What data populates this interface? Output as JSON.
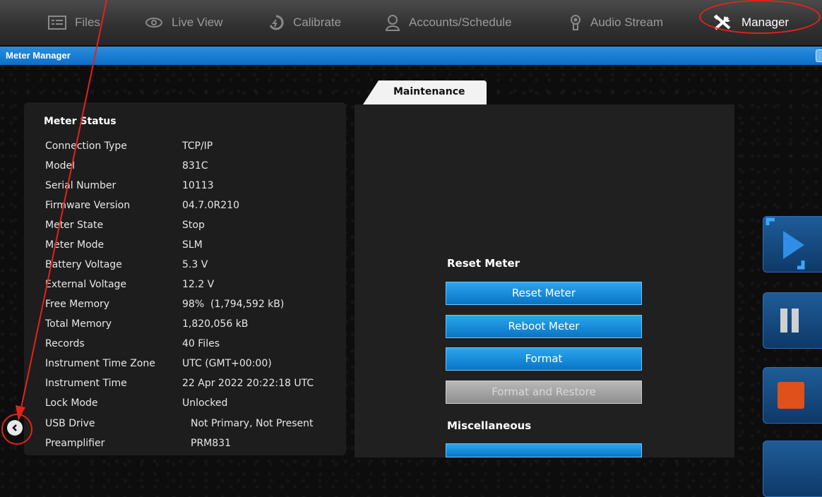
{
  "nav": {
    "items": [
      {
        "label": "Files",
        "icon": "files-icon"
      },
      {
        "label": "Live View",
        "icon": "eye-icon"
      },
      {
        "label": "Calibrate",
        "icon": "calibrate-icon"
      },
      {
        "label": "Accounts/Schedule",
        "icon": "user-icon"
      },
      {
        "label": "Audio Stream",
        "icon": "microphone-icon"
      },
      {
        "label": "Manager",
        "icon": "tools-icon",
        "active": true
      }
    ]
  },
  "window": {
    "title": "Meter Manager"
  },
  "status": {
    "title": "Meter Status",
    "rows": [
      {
        "label": "Connection Type",
        "value": "TCP/IP"
      },
      {
        "label": "Model",
        "value": "831C"
      },
      {
        "label": "Serial Number",
        "value": "10113"
      },
      {
        "label": "Firmware Version",
        "value": "04.7.0R210"
      },
      {
        "label": "Meter State",
        "value": "Stop"
      },
      {
        "label": "Meter Mode",
        "value": "SLM"
      },
      {
        "label": "Battery Voltage",
        "value": "5.3 V"
      },
      {
        "label": "External Voltage",
        "value": "12.2 V"
      },
      {
        "label": "Free Memory",
        "value": "98%  (1,794,592 kB)"
      },
      {
        "label": "Total Memory",
        "value": "1,820,056 kB"
      },
      {
        "label": "Records",
        "value": "40 Files"
      },
      {
        "label": "Instrument Time Zone",
        "value": "UTC (GMT+00:00)"
      },
      {
        "label": "Instrument Time",
        "value": "22 Apr 2022 20:22:18 UTC"
      },
      {
        "label": "Lock Mode",
        "value": "Unlocked"
      },
      {
        "label": "USB Drive",
        "value": "Not Primary, Not Present"
      },
      {
        "label": "Preamplifier",
        "value": "PRM831"
      }
    ]
  },
  "maintenance": {
    "tab_label": "Maintenance",
    "reset_section": "Reset Meter",
    "buttons": {
      "reset": "Reset Meter",
      "reboot": "Reboot Meter",
      "format": "Format",
      "format_restore": "Format and Restore"
    },
    "misc_section": "Miscellaneous"
  },
  "colors": {
    "accent": "#1590dc",
    "annotation": "#e2231a",
    "stop": "#e0501a"
  }
}
